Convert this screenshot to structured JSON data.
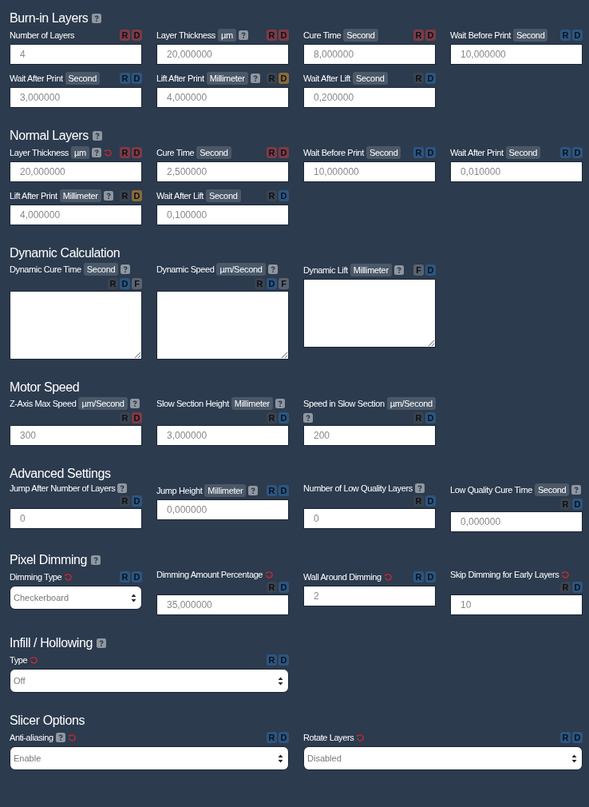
{
  "sections": [
    {
      "title": "Burn-in Layers",
      "help": true,
      "fields": [
        {
          "label": "Number of Layers",
          "kind": "input",
          "value": "4",
          "badges": [
            {
              "text": "R",
              "color": "#7d3a45"
            },
            {
              "text": "D",
              "color": "#7d3a45"
            }
          ]
        },
        {
          "label": "Layer Thickness",
          "unit": "µm",
          "help": true,
          "kind": "input",
          "value": "20,000000",
          "badges": [
            {
              "text": "R",
              "color": "#7d3a45"
            },
            {
              "text": "D",
              "color": "#7d3a45"
            }
          ]
        },
        {
          "label": "Cure Time",
          "unit": "Second",
          "kind": "input",
          "value": "8,000000",
          "badges": [
            {
              "text": "R",
              "color": "#7d3a45"
            },
            {
              "text": "D",
              "color": "#7d3a45"
            }
          ]
        },
        {
          "label": "Wait Before Print",
          "unit": "Second",
          "kind": "input",
          "value": "10,000000",
          "badges": [
            {
              "text": "R",
              "color": "#2c5580"
            },
            {
              "text": "D",
              "color": "#2c5580"
            }
          ]
        },
        {
          "label": "Wait After Print",
          "unit": "Second",
          "kind": "input",
          "value": "3,000000",
          "badges": [
            {
              "text": "R",
              "color": "#2c5580"
            },
            {
              "text": "D",
              "color": "#2c5580"
            }
          ]
        },
        {
          "label": "Lift After Print",
          "unit": "Millimeter",
          "help": true,
          "kind": "input",
          "value": "4,000000",
          "badges": [
            {
              "text": "R",
              "color": "#3b434d"
            },
            {
              "text": "D",
              "color": "#8a6a3c"
            }
          ]
        },
        {
          "label": "Wait After Lift",
          "unit": "Second",
          "kind": "input",
          "value": "0,200000",
          "badges": [
            {
              "text": "R",
              "color": "#3b434d"
            },
            {
              "text": "D",
              "color": "#2c5580"
            }
          ]
        }
      ]
    },
    {
      "title": "Normal Layers",
      "help": true,
      "fields": [
        {
          "label": "Layer Thickness",
          "unit": "µm",
          "help": true,
          "reset": true,
          "kind": "input",
          "value": "20,000000",
          "badges": [
            {
              "text": "R",
              "color": "#7d3a45"
            },
            {
              "text": "D",
              "color": "#7d3a45"
            }
          ]
        },
        {
          "label": "Cure Time",
          "unit": "Second",
          "kind": "input",
          "value": "2,500000",
          "badges": [
            {
              "text": "R",
              "color": "#7d3a45"
            },
            {
              "text": "D",
              "color": "#7d3a45"
            }
          ]
        },
        {
          "label": "Wait Before Print",
          "unit": "Second",
          "kind": "input",
          "value": "10,000000",
          "badges": [
            {
              "text": "R",
              "color": "#2c5580"
            },
            {
              "text": "D",
              "color": "#2c5580"
            }
          ]
        },
        {
          "label": "Wait After Print",
          "unit": "Second",
          "kind": "input",
          "value": "0,010000",
          "badges": [
            {
              "text": "R",
              "color": "#2c5580"
            },
            {
              "text": "D",
              "color": "#2c5580"
            }
          ]
        },
        {
          "label": "Lift After Print",
          "unit": "Millimeter",
          "help": true,
          "kind": "input",
          "value": "4,000000",
          "badges": [
            {
              "text": "R",
              "color": "#3b434d"
            },
            {
              "text": "D",
              "color": "#8a6a3c"
            }
          ]
        },
        {
          "label": "Wait After Lift",
          "unit": "Second",
          "kind": "input",
          "value": "0,100000",
          "badges": [
            {
              "text": "R",
              "color": "#3b434d"
            },
            {
              "text": "D",
              "color": "#2c5580"
            }
          ]
        }
      ]
    },
    {
      "title": "Dynamic Calculation",
      "help": false,
      "fields": [
        {
          "label": "Dynamic Cure Time",
          "unit": "Second",
          "help": true,
          "kind": "textarea",
          "badges": [
            {
              "text": "R",
              "color": "#3b434d"
            },
            {
              "text": "D",
              "color": "#2c5580"
            },
            {
              "text": "F",
              "color": "#5b6370"
            }
          ]
        },
        {
          "label": "Dynamic Speed",
          "unit": "µm/Second",
          "help": true,
          "kind": "textarea",
          "badges": [
            {
              "text": "R",
              "color": "#3b434d"
            },
            {
              "text": "D",
              "color": "#2c5580"
            },
            {
              "text": "F",
              "color": "#5b6370"
            }
          ]
        },
        {
          "label": "Dynamic Lift",
          "unit": "Millimeter",
          "help": true,
          "kind": "textarea",
          "badges": [
            {
              "text": "F",
              "color": "#5b6370"
            },
            {
              "text": "D",
              "color": "#2c5580"
            }
          ]
        }
      ]
    },
    {
      "title": "Motor Speed",
      "help": false,
      "fields": [
        {
          "label": "Z-Axis Max Speed",
          "unit": "µm/Second",
          "help": true,
          "kind": "input",
          "value": "300",
          "badges": [
            {
              "text": "R",
              "color": "#3b434d"
            },
            {
              "text": "D",
              "color": "#7d3a45"
            }
          ]
        },
        {
          "label": "Slow Section Height",
          "unit": "Millimeter",
          "help": true,
          "kind": "input",
          "value": "3,000000",
          "badges": [
            {
              "text": "R",
              "color": "#3b434d"
            },
            {
              "text": "D",
              "color": "#2c5580"
            }
          ]
        },
        {
          "label": "Speed in Slow Section",
          "unit": "µm/Second",
          "help": true,
          "kind": "input",
          "value": "200",
          "badges": [
            {
              "text": "R",
              "color": "#3b434d"
            },
            {
              "text": "D",
              "color": "#2c5580"
            }
          ]
        }
      ]
    },
    {
      "title": "Advanced Settings",
      "help": false,
      "fields": [
        {
          "label": "Jump After Number of Layers",
          "help": true,
          "kind": "input",
          "value": "0",
          "badges": [
            {
              "text": "R",
              "color": "#3b434d"
            },
            {
              "text": "D",
              "color": "#2c5580"
            }
          ]
        },
        {
          "label": "Jump Height",
          "unit": "Millimeter",
          "help": true,
          "kind": "input",
          "value": "0,000000",
          "badges": [
            {
              "text": "R",
              "color": "#2c5580"
            },
            {
              "text": "D",
              "color": "#2c5580"
            }
          ]
        },
        {
          "label": "Number of Low Quality Layers",
          "help": true,
          "kind": "input",
          "value": "0",
          "badges": [
            {
              "text": "R",
              "color": "#3b434d"
            },
            {
              "text": "D",
              "color": "#2c5580"
            }
          ]
        },
        {
          "label": "Low Quality Cure Time",
          "unit": "Second",
          "help": true,
          "kind": "input",
          "value": "0,000000",
          "badges": [
            {
              "text": "R",
              "color": "#3b434d"
            },
            {
              "text": "D",
              "color": "#2c5580"
            }
          ]
        }
      ]
    },
    {
      "title": "Pixel Dimming",
      "help": true,
      "fields": [
        {
          "label": "Dimming Type",
          "reset": true,
          "kind": "select",
          "value": "Checkerboard",
          "badges": [
            {
              "text": "R",
              "color": "#2c5580"
            },
            {
              "text": "D",
              "color": "#2c5580"
            }
          ]
        },
        {
          "label": "Dimming Amount Percentage",
          "reset": true,
          "kind": "input",
          "value": "35,000000",
          "badges": [
            {
              "text": "R",
              "color": "#3b434d"
            },
            {
              "text": "D",
              "color": "#2c5580"
            }
          ]
        },
        {
          "label": "Wall Around Dimming",
          "reset": true,
          "kind": "input",
          "value": "2",
          "badges": [
            {
              "text": "R",
              "color": "#2c5580"
            },
            {
              "text": "D",
              "color": "#2c5580"
            }
          ]
        },
        {
          "label": "Skip Dimming for Early Layers",
          "reset": true,
          "kind": "input",
          "value": "10",
          "badges": [
            {
              "text": "R",
              "color": "#3b434d"
            },
            {
              "text": "D",
              "color": "#2c5580"
            }
          ]
        }
      ]
    },
    {
      "title": "Infill / Hollowing",
      "help": true,
      "fields": [
        {
          "label": "Type",
          "reset": true,
          "kind": "select",
          "value": "Off",
          "badges": [
            {
              "text": "R",
              "color": "#2c5580"
            },
            {
              "text": "D",
              "color": "#2c5580"
            }
          ]
        }
      ]
    },
    {
      "title": "Slicer Options",
      "help": false,
      "fields": [
        {
          "label": "Anti-aliasing",
          "help": true,
          "reset": true,
          "kind": "select",
          "value": "Enable",
          "badges": [
            {
              "text": "R",
              "color": "#2c5580"
            },
            {
              "text": "D",
              "color": "#2c5580"
            }
          ]
        },
        {
          "label": "Rotate Layers",
          "reset": true,
          "kind": "select",
          "value": "Disabled",
          "badges": [
            {
              "text": "R",
              "color": "#2c5580"
            },
            {
              "text": "D",
              "color": "#2c5580"
            }
          ]
        }
      ]
    }
  ]
}
